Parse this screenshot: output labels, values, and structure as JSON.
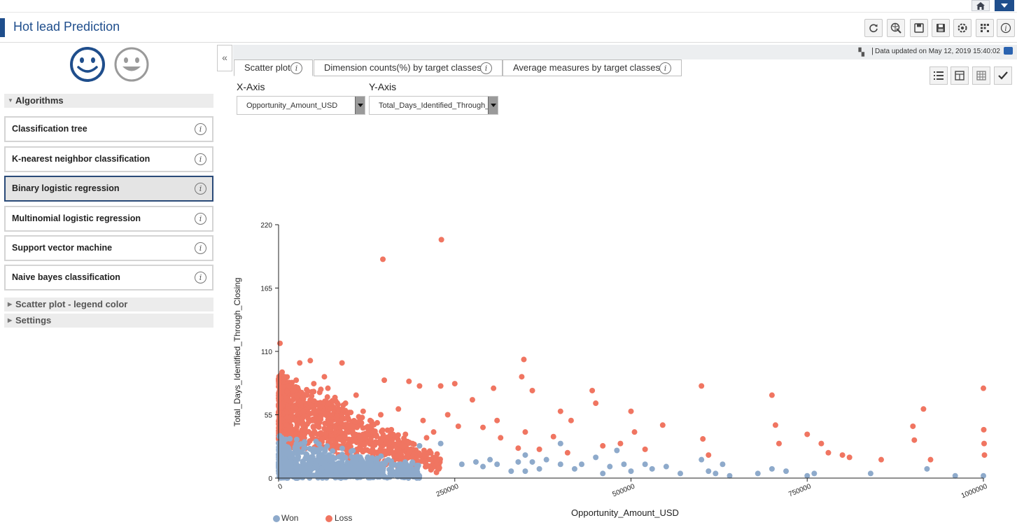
{
  "app": {
    "title": "Hot lead Prediction"
  },
  "toolbar": {
    "icons": [
      "refresh-icon",
      "share-icon",
      "save-icon",
      "save-as-icon",
      "settings-icon",
      "layout-icon",
      "info-icon"
    ]
  },
  "left": {
    "algorithms_header": "Algorithms",
    "algorithms": [
      {
        "label": "Classification tree",
        "selected": false
      },
      {
        "label": "K-nearest neighbor classification",
        "selected": false
      },
      {
        "label": "Binary logistic regression",
        "selected": true
      },
      {
        "label": "Multinomial logistic regression",
        "selected": false
      },
      {
        "label": "Support vector machine",
        "selected": false
      },
      {
        "label": "Naive bayes classification",
        "selected": false
      }
    ],
    "section_legend": "Scatter plot - legend color",
    "section_settings": "Settings",
    "collapse_glyph": "«"
  },
  "status": {
    "text": "Data updated on May 12, 2019 15:40:02",
    "separator": "|"
  },
  "tabs": [
    {
      "label": "Scatter plot",
      "active": true
    },
    {
      "label": "Dimension counts(%) by target classes",
      "active": false
    },
    {
      "label": "Average measures by target classes",
      "active": false
    }
  ],
  "axes": {
    "x_label": "X-Axis",
    "y_label": "Y-Axis",
    "x_value": "Opportunity_Amount_USD",
    "y_value": "Total_Days_Identified_Through_Closing"
  },
  "colors": {
    "won": "#8eaacb",
    "loss": "#f07561",
    "brand": "#1f4e8c"
  },
  "chart_data": {
    "type": "scatter",
    "xlabel": "Opportunity_Amount_USD",
    "ylabel": "Total_Days_Identified_Through_Closing",
    "xlim": [
      0,
      1000000
    ],
    "ylim": [
      0,
      220
    ],
    "xticks": [
      0,
      250000,
      500000,
      750000,
      1000000
    ],
    "yticks": [
      0,
      55,
      110,
      165,
      220
    ],
    "legend_position": "bottom-left",
    "series": [
      {
        "name": "Won",
        "color": "#8eaacb",
        "points": [
          [
            200000,
            28
          ],
          [
            230000,
            30
          ],
          [
            260000,
            12
          ],
          [
            280000,
            14
          ],
          [
            290000,
            10
          ],
          [
            300000,
            16
          ],
          [
            310000,
            12
          ],
          [
            330000,
            6
          ],
          [
            340000,
            14
          ],
          [
            350000,
            20
          ],
          [
            350000,
            6
          ],
          [
            360000,
            14
          ],
          [
            370000,
            8
          ],
          [
            380000,
            16
          ],
          [
            400000,
            30
          ],
          [
            400000,
            12
          ],
          [
            420000,
            8
          ],
          [
            430000,
            12
          ],
          [
            450000,
            18
          ],
          [
            460000,
            4
          ],
          [
            470000,
            10
          ],
          [
            480000,
            24
          ],
          [
            490000,
            12
          ],
          [
            500000,
            6
          ],
          [
            520000,
            12
          ],
          [
            530000,
            8
          ],
          [
            550000,
            10
          ],
          [
            570000,
            4
          ],
          [
            600000,
            16
          ],
          [
            610000,
            6
          ],
          [
            620000,
            4
          ],
          [
            630000,
            12
          ],
          [
            640000,
            2
          ],
          [
            680000,
            4
          ],
          [
            700000,
            8
          ],
          [
            720000,
            6
          ],
          [
            750000,
            2
          ],
          [
            760000,
            4
          ],
          [
            840000,
            4
          ],
          [
            920000,
            8
          ],
          [
            960000,
            2
          ],
          [
            1000000,
            2
          ]
        ]
      },
      {
        "name": "Loss",
        "color": "#f07561",
        "points": [
          [
            2000,
            117
          ],
          [
            5000,
            92
          ],
          [
            8000,
            88
          ],
          [
            10000,
            70
          ],
          [
            12000,
            75
          ],
          [
            15000,
            80
          ],
          [
            20000,
            62
          ],
          [
            25000,
            85
          ],
          [
            30000,
            100
          ],
          [
            35000,
            58
          ],
          [
            40000,
            72
          ],
          [
            45000,
            102
          ],
          [
            50000,
            82
          ],
          [
            55000,
            65
          ],
          [
            60000,
            77
          ],
          [
            65000,
            88
          ],
          [
            70000,
            78
          ],
          [
            75000,
            55
          ],
          [
            80000,
            70
          ],
          [
            85000,
            60
          ],
          [
            90000,
            100
          ],
          [
            95000,
            65
          ],
          [
            100000,
            57
          ],
          [
            105000,
            45
          ],
          [
            110000,
            72
          ],
          [
            115000,
            35
          ],
          [
            120000,
            58
          ],
          [
            125000,
            44
          ],
          [
            130000,
            50
          ],
          [
            140000,
            48
          ],
          [
            145000,
            55
          ],
          [
            148000,
            190
          ],
          [
            150000,
            85
          ],
          [
            160000,
            42
          ],
          [
            170000,
            60
          ],
          [
            180000,
            38
          ],
          [
            185000,
            84
          ],
          [
            190000,
            30
          ],
          [
            200000,
            80
          ],
          [
            205000,
            50
          ],
          [
            210000,
            35
          ],
          [
            220000,
            40
          ],
          [
            230000,
            80
          ],
          [
            231000,
            207
          ],
          [
            240000,
            55
          ],
          [
            250000,
            82
          ],
          [
            255000,
            45
          ],
          [
            275000,
            68
          ],
          [
            290000,
            44
          ],
          [
            305000,
            78
          ],
          [
            310000,
            50
          ],
          [
            315000,
            35
          ],
          [
            340000,
            26
          ],
          [
            345000,
            88
          ],
          [
            348000,
            103
          ],
          [
            350000,
            40
          ],
          [
            360000,
            76
          ],
          [
            370000,
            25
          ],
          [
            390000,
            36
          ],
          [
            400000,
            58
          ],
          [
            410000,
            22
          ],
          [
            415000,
            50
          ],
          [
            445000,
            76
          ],
          [
            450000,
            65
          ],
          [
            460000,
            28
          ],
          [
            485000,
            30
          ],
          [
            500000,
            58
          ],
          [
            505000,
            40
          ],
          [
            520000,
            25
          ],
          [
            545000,
            46
          ],
          [
            600000,
            80
          ],
          [
            602000,
            34
          ],
          [
            610000,
            20
          ],
          [
            700000,
            72
          ],
          [
            705000,
            46
          ],
          [
            710000,
            30
          ],
          [
            750000,
            38
          ],
          [
            770000,
            30
          ],
          [
            780000,
            22
          ],
          [
            800000,
            20
          ],
          [
            810000,
            18
          ],
          [
            855000,
            16
          ],
          [
            900000,
            45
          ],
          [
            902000,
            33
          ],
          [
            915000,
            60
          ],
          [
            925000,
            16
          ],
          [
            1000000,
            78
          ],
          [
            1000500,
            42
          ],
          [
            1001000,
            30
          ],
          [
            1001500,
            20
          ]
        ]
      }
    ]
  }
}
